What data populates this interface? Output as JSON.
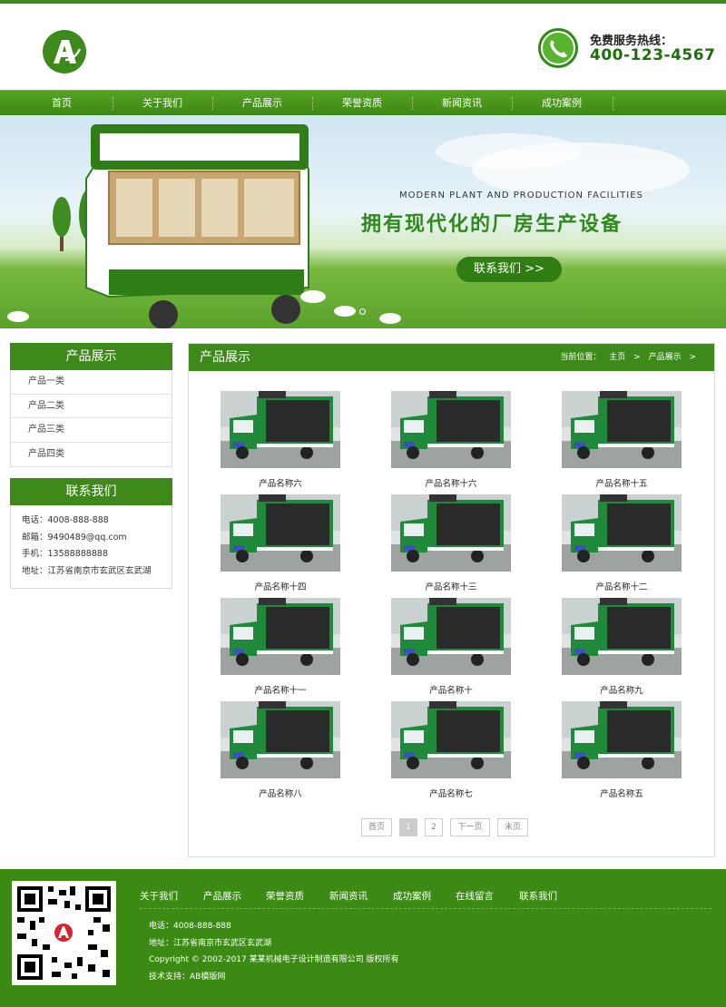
{
  "header": {
    "hotline_label": "免费服务热线：",
    "hotline_number": "400-123-4567"
  },
  "nav": [
    "首页",
    "关于我们",
    "产品展示",
    "荣誉资质",
    "新闻资讯",
    "成功案例"
  ],
  "banner": {
    "subtitle_en": "MODERN PLANT AND PRODUCTION FACILITIES",
    "headline": "拥有现代化的厂房生产设备",
    "cta": "联系我们 >>"
  },
  "sidebar": {
    "categories_title": "产品展示",
    "categories": [
      "产品一类",
      "产品二类",
      "产品三类",
      "产品四类"
    ],
    "contact_title": "联系我们",
    "contact": [
      "电话：4008-888-888",
      "邮箱：9490489@qq.com",
      "手机：13588888888",
      "地址：江苏省南京市玄武区玄武湖"
    ]
  },
  "main": {
    "title": "产品展示",
    "breadcrumb": [
      "当前位置：",
      "主页",
      ">",
      "产品展示",
      ">"
    ],
    "products": [
      "产品名称六",
      "产品名称十六",
      "产品名称十五",
      "产品名称十四",
      "产品名称十三",
      "产品名称十二",
      "产品名称十一",
      "产品名称十",
      "产品名称九",
      "产品名称八",
      "产品名称七",
      "产品名称五"
    ],
    "pagination": [
      "首页",
      "1",
      "2",
      "下一页",
      "末页"
    ]
  },
  "footer": {
    "nav": [
      "关于我们",
      "产品展示",
      "荣誉资质",
      "新闻资讯",
      "成功案例",
      "在线留言",
      "联系我们"
    ],
    "info": [
      "电话：4008-888-888",
      "地址：江苏省南京市玄武区玄武湖",
      "Copyright © 2002-2017 某某机械电子设计制造有限公司 版权所有",
      "技术支持：AB模版网"
    ]
  },
  "colors": {
    "brand": "#3d8a1b",
    "accent": "#1f6d0e"
  },
  "icons": {
    "logo": "logo-a-icon",
    "phone": "phone-icon",
    "qr": "qr-code-icon"
  }
}
